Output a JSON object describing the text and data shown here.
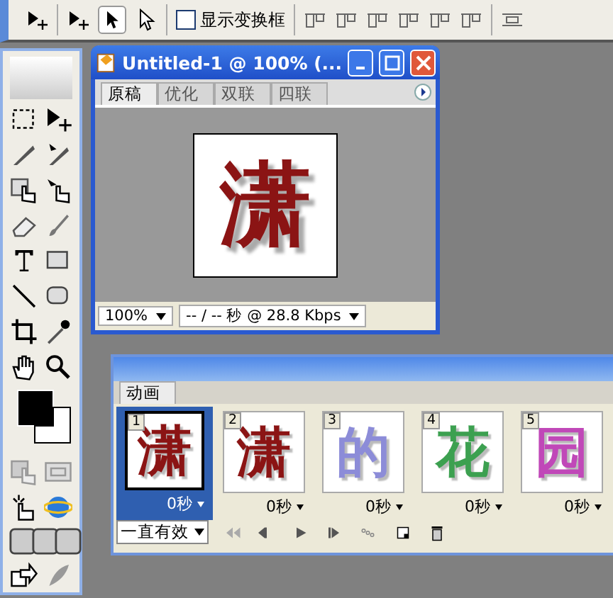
{
  "options_bar": {
    "checkbox": {
      "label": "显示变换框",
      "checked": false
    }
  },
  "document_window": {
    "title": "Untitled-1 @ 100% (...",
    "tabs": [
      {
        "label": "原稿",
        "selected": true
      },
      {
        "label": "优化",
        "selected": false
      },
      {
        "label": "双联",
        "selected": false
      },
      {
        "label": "四联",
        "selected": false
      }
    ],
    "canvas_glyph": "潇",
    "zoom": "100%",
    "status": "-- / -- 秒 @ 28.8 Kbps"
  },
  "animation_panel": {
    "tab": "动画",
    "frames": [
      {
        "number": "1",
        "glyph": "潇",
        "color": "#8b1414",
        "delay": "0秒",
        "selected": true
      },
      {
        "number": "2",
        "glyph": "潇",
        "color": "#8b1414",
        "delay": "0秒",
        "selected": false
      },
      {
        "number": "3",
        "glyph": "的",
        "color": "#8c8cd8",
        "delay": "0秒",
        "selected": false
      },
      {
        "number": "4",
        "glyph": "花",
        "color": "#3ca050",
        "delay": "0秒",
        "selected": false
      },
      {
        "number": "5",
        "glyph": "园",
        "color": "#c048b8",
        "delay": "0秒",
        "selected": false
      }
    ],
    "loop": "一直有效"
  }
}
